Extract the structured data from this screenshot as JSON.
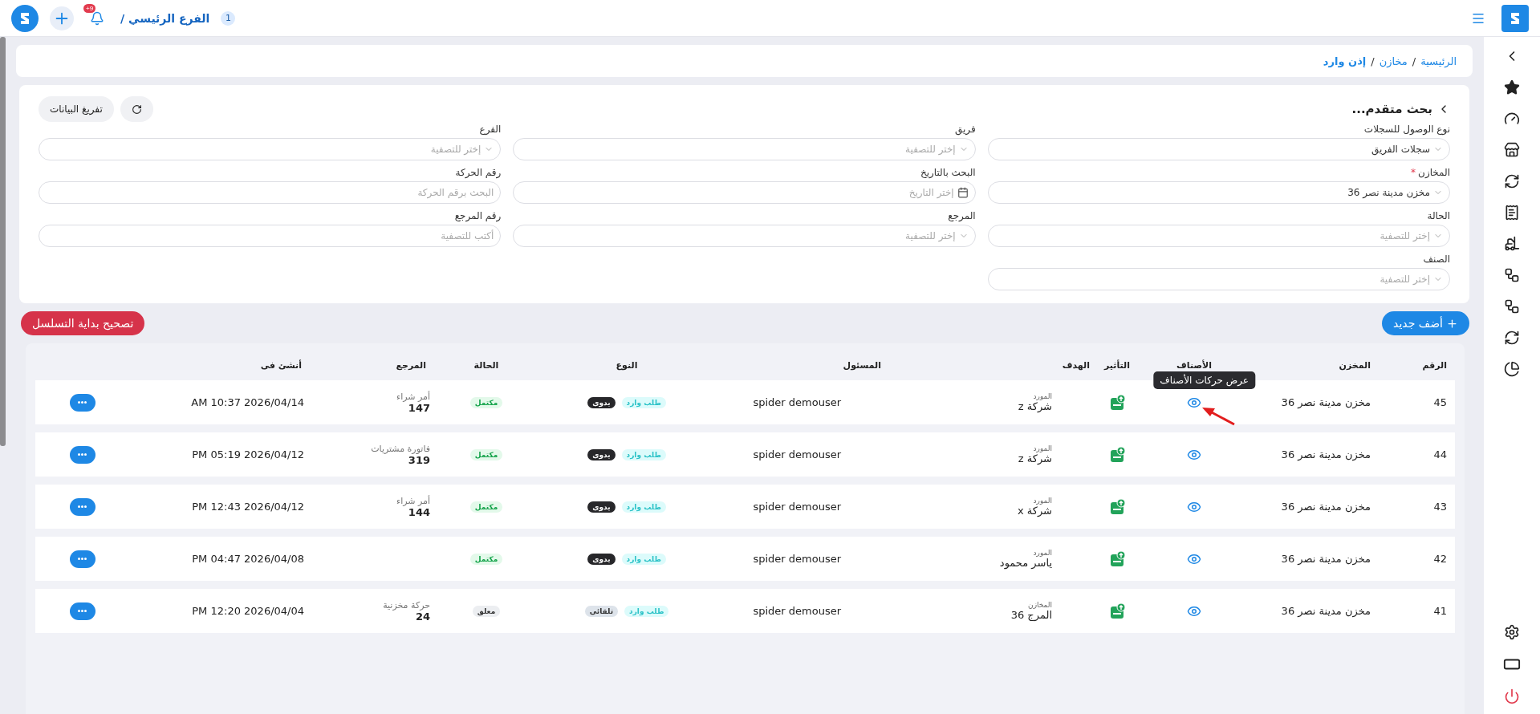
{
  "topbar": {
    "branch_number": "1",
    "branch": "الفرع الرئيسي /",
    "notifications": "+9"
  },
  "breadcrumb": [
    {
      "label": "الرئيسية",
      "current": false
    },
    {
      "separator": "/",
      "label": "مخازن",
      "current": false
    },
    {
      "separator": "/",
      "label": "إذن وارد",
      "current": true
    }
  ],
  "filters": {
    "title": "بحث متقدم...",
    "clear_button": "تفريغ البيانات",
    "fields": [
      {
        "label": "نوع الوصول للسجلات",
        "kind": "select",
        "value": "سجلات الفريق"
      },
      {
        "label": "فريق",
        "kind": "select",
        "placeholder": "إختر للتصفية"
      },
      {
        "label": "الفرع",
        "kind": "select",
        "placeholder": "إختر للتصفية"
      },
      {
        "label": "المخازن",
        "required_mark": "*",
        "kind": "select",
        "value": "مخزن مدينة نصر 36"
      },
      {
        "label": "البحث بالتاريخ",
        "kind": "date",
        "placeholder": "إختر التاريخ"
      },
      {
        "label": "رقم الحركة",
        "kind": "text",
        "placeholder": "البحث برقم الحركة"
      },
      {
        "label": "الحالة",
        "kind": "select",
        "placeholder": "إختر للتصفية"
      },
      {
        "label": "المرجع",
        "kind": "select",
        "placeholder": "إختر للتصفية"
      },
      {
        "label": "رقم المرجع",
        "kind": "text",
        "placeholder": "أكتب للتصفية"
      },
      {
        "label": "الصنف",
        "kind": "select",
        "placeholder": "إختر للتصفية"
      }
    ]
  },
  "actions": {
    "add": "أضف جديد",
    "fix_sequence": "تصحيح بداية التسلسل"
  },
  "table": {
    "columns": [
      "الرقم",
      "المخزن",
      "الأصناف",
      "التأثير",
      "الهدف",
      "المسئول",
      "النوع",
      "الحالة",
      "المرجع",
      "أنشئ فى"
    ],
    "rows": [
      {
        "number": "45",
        "warehouse": "مخزن مدينة نصر 36",
        "target_label": "المورد",
        "target": "شركة z",
        "responsible": "spider demouser",
        "request": "طلب وارد",
        "mode": {
          "text": "يدوى",
          "color": "#27272a"
        },
        "status": {
          "text": "مكتمل",
          "color": "#14a34a"
        },
        "ref_label": "أمر شراء",
        "ref_number": "147",
        "created": "AM 10:37 2026/04/14",
        "tooltip": "عرض حركات الأصناف"
      },
      {
        "number": "44",
        "warehouse": "مخزن مدينة نصر 36",
        "target_label": "المورد",
        "target": "شركة z",
        "responsible": "spider demouser",
        "request": "طلب وارد",
        "mode": {
          "text": "يدوى",
          "color": "#27272a"
        },
        "status": {
          "text": "مكتمل",
          "color": "#14a34a"
        },
        "ref_label": "فاتورة مشتريات",
        "ref_number": "319",
        "created": "PM 05:19 2026/04/12"
      },
      {
        "number": "43",
        "warehouse": "مخزن مدينة نصر 36",
        "target_label": "المورد",
        "target": "شركة x",
        "responsible": "spider demouser",
        "request": "طلب وارد",
        "mode": {
          "text": "يدوى",
          "color": "#27272a"
        },
        "status": {
          "text": "مكتمل",
          "color": "#14a34a"
        },
        "ref_label": "أمر شراء",
        "ref_number": "144",
        "created": "PM 12:43 2026/04/12"
      },
      {
        "number": "42",
        "warehouse": "مخزن مدينة نصر 36",
        "target_label": "المورد",
        "target": "ياسر محمود",
        "responsible": "spider demouser",
        "request": "طلب وارد",
        "mode": {
          "text": "يدوى",
          "color": "#27272a"
        },
        "status": {
          "text": "مكتمل",
          "color": "#14a34a"
        },
        "created": "PM 04:47 2026/04/08"
      },
      {
        "number": "41",
        "warehouse": "مخزن مدينة نصر 36",
        "target_label": "المخازن",
        "target": "المرج 36",
        "responsible": "spider demouser",
        "request": "طلب وارد",
        "mode": {
          "text": "تلقائى",
          "color": "#dde3ea"
        },
        "status": {
          "text": "معلق",
          "color": "#333333"
        },
        "ref_label": "حركة مخزنية",
        "ref_number": "24",
        "created": "PM 12:20 2026/04/04"
      }
    ]
  }
}
